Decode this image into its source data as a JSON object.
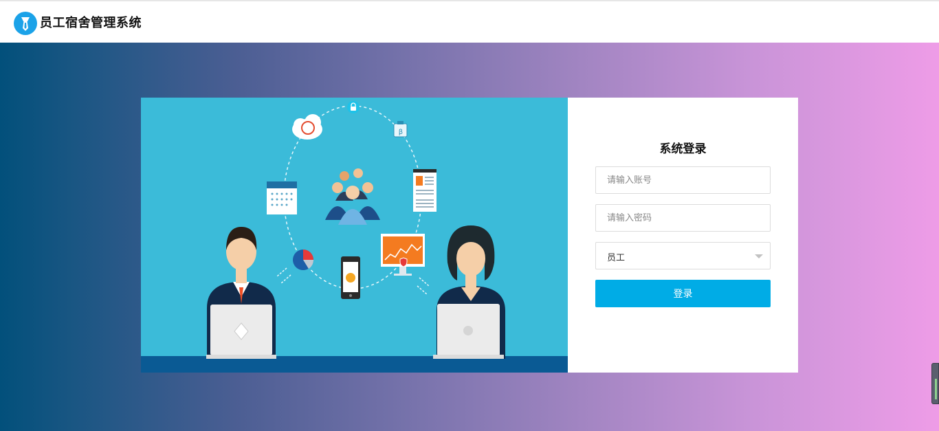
{
  "header": {
    "title": "员工宿舍管理系统",
    "logo_icon": "tie-icon",
    "logo_color": "#1ba2e8"
  },
  "background": {
    "gradient_start": "#02507b",
    "gradient_end": "#ee9ce7"
  },
  "login": {
    "title": "系统登录",
    "username_placeholder": "请输入账号",
    "password_placeholder": "请输入密码",
    "role_selected": "员工",
    "submit_label": "登录",
    "accent_color": "#00ace6"
  },
  "illustration": {
    "background_color": "#3bbbd9",
    "icons": [
      "cloud-sync-icon",
      "lock-icon",
      "calendar-icon",
      "clipboard-icon",
      "document-icon",
      "team-icon",
      "pie-chart-icon",
      "smartphone-icon",
      "monitor-chart-icon",
      "businessman-laptop",
      "businesswoman-laptop"
    ]
  }
}
